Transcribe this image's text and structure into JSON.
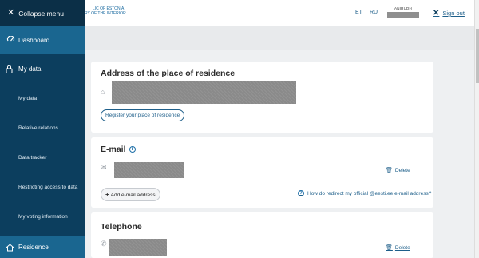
{
  "sidebar": {
    "collapse_label": "Collapse menu",
    "dashboard": "Dashboard",
    "my_data_section": "My data",
    "items": [
      "My data",
      "Relative relations",
      "Data tracker",
      "Restricting access to data",
      "My voting information"
    ],
    "residence": "Residence"
  },
  "header": {
    "logo_line1": "LIC OF ESTONIA",
    "logo_line2": "RY OF THE INTERIOR",
    "lang_et": "ET",
    "lang_ru": "RU",
    "user_name": "ANIRUDH",
    "signout": "Sign out"
  },
  "address": {
    "title": "Address of the place of residence",
    "register_button": "Register your place of residence"
  },
  "email": {
    "title": "E-mail",
    "delete": "Delete",
    "add_button": "Add e-mail address",
    "help_link": "How do redirect my official @eesti.ee e-mail address?"
  },
  "telephone": {
    "title": "Telephone",
    "delete": "Delete"
  }
}
